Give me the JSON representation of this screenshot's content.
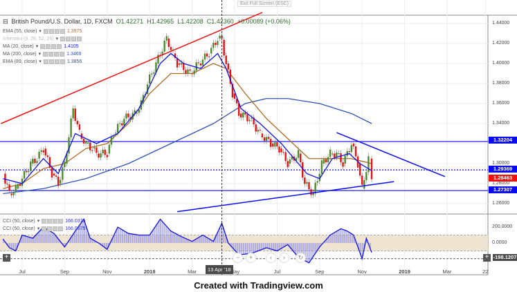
{
  "header": {
    "exit_fullscreen": "Exit Full Screen (ESC)",
    "symbol": "British Pound/U.S. Dollar, 1D, FXCM",
    "open": "O1.42271",
    "high": "H1.42965",
    "low": "L1.42208",
    "close": "C1.42360",
    "change": "+0.00089 (+0.06%)"
  },
  "indicators": [
    {
      "label": "EMA (55, close)",
      "value": "1.3975",
      "color": "#c06a10"
    },
    {
      "label": "Ichimoku (9, 26, 52, 26)",
      "value": "",
      "color": "#bbbbbb"
    },
    {
      "label": "MA (20, close)",
      "value": "1.4105",
      "color": "#1010e0"
    },
    {
      "label": "MA (200, close)",
      "value": "1.3469",
      "color": "#3050b0"
    },
    {
      "label": "EMA (89, close)",
      "value": "1.3856",
      "color": "#3050b0"
    }
  ],
  "cci_legend": [
    {
      "label": "CCI (50, close)",
      "value": "166.0375"
    },
    {
      "label": "CCI (50, close)",
      "value": "166.0375"
    }
  ],
  "price_badges": [
    {
      "value": "1.32204",
      "color": "#0a0af0"
    },
    {
      "value": "1.29369",
      "color": "#0a0af0"
    },
    {
      "value": "1.28463",
      "color": "#f01010"
    },
    {
      "value": "1.27307",
      "color": "#0a0af0"
    }
  ],
  "cci_axis": {
    "ticks": [
      "200.0000",
      "0.0000"
    ],
    "badge": "-198.1207"
  },
  "crosshair_date": "13 Apr '18",
  "footer": "Created with Tradingview.com",
  "nav": {
    "zoom_out": "−",
    "zoom_in": "+",
    "left": "‹",
    "right": "›",
    "reset": "↻"
  },
  "chart_data": {
    "type": "candlestick",
    "title": "British Pound/U.S. Dollar, 1D, FXCM",
    "ylim": [
      1.25,
      1.45
    ],
    "y_ticks": [
      "1.44000",
      "1.42000",
      "1.40000",
      "1.38000",
      "1.36000",
      "1.34000",
      "1.30000",
      "1.28000",
      "1.26000"
    ],
    "x_ticks": [
      {
        "label": "Jul",
        "t": 0
      },
      {
        "label": "Sep",
        "t": 2
      },
      {
        "label": "Nov",
        "t": 4
      },
      {
        "label": "2018",
        "t": 6
      },
      {
        "label": "Mar",
        "t": 8
      },
      {
        "label": "May",
        "t": 10
      },
      {
        "label": "Jul",
        "t": 12
      },
      {
        "label": "Sep",
        "t": 14
      },
      {
        "label": "Nov",
        "t": 16
      },
      {
        "label": "2019",
        "t": 18
      },
      {
        "label": "Mar",
        "t": 20
      },
      {
        "label": "22",
        "t": 21.8
      }
    ],
    "x_unit": "months since Jul 2017",
    "close": [
      [
        -0.9,
        1.29
      ],
      [
        -0.6,
        1.27
      ],
      [
        -0.3,
        1.275
      ],
      [
        0,
        1.285
      ],
      [
        0.4,
        1.3
      ],
      [
        0.7,
        1.305
      ],
      [
        1,
        1.315
      ],
      [
        1.4,
        1.29
      ],
      [
        1.7,
        1.28
      ],
      [
        2,
        1.3
      ],
      [
        2.4,
        1.355
      ],
      [
        2.7,
        1.33
      ],
      [
        3,
        1.32
      ],
      [
        3.3,
        1.315
      ],
      [
        3.5,
        1.31
      ],
      [
        4,
        1.31
      ],
      [
        4.3,
        1.33
      ],
      [
        4.8,
        1.345
      ],
      [
        5.3,
        1.35
      ],
      [
        5.6,
        1.36
      ],
      [
        5.9,
        1.38
      ],
      [
        6.3,
        1.4
      ],
      [
        6.8,
        1.425
      ],
      [
        7.1,
        1.41
      ],
      [
        7.3,
        1.4
      ],
      [
        7.9,
        1.39
      ],
      [
        8.3,
        1.4
      ],
      [
        8.8,
        1.41
      ],
      [
        9.2,
        1.425
      ],
      [
        9.4,
        1.4236
      ],
      [
        9.6,
        1.4
      ],
      [
        9.9,
        1.37
      ],
      [
        10.2,
        1.35
      ],
      [
        10.7,
        1.345
      ],
      [
        11.2,
        1.33
      ],
      [
        11.7,
        1.32
      ],
      [
        12.1,
        1.315
      ],
      [
        12.5,
        1.3
      ],
      [
        13,
        1.31
      ],
      [
        13.3,
        1.28
      ],
      [
        13.7,
        1.27
      ],
      [
        14.1,
        1.3
      ],
      [
        14.5,
        1.31
      ],
      [
        14.8,
        1.31
      ],
      [
        15.1,
        1.3
      ],
      [
        15.5,
        1.32
      ],
      [
        15.8,
        1.3
      ],
      [
        16,
        1.275
      ],
      [
        16.3,
        1.305
      ],
      [
        16.45,
        1.2846
      ]
    ],
    "ma20": [
      [
        -0.9,
        1.285
      ],
      [
        0,
        1.28
      ],
      [
        1,
        1.305
      ],
      [
        1.7,
        1.29
      ],
      [
        2.5,
        1.33
      ],
      [
        3.5,
        1.32
      ],
      [
        4.5,
        1.33
      ],
      [
        5.5,
        1.355
      ],
      [
        6.5,
        1.4
      ],
      [
        7,
        1.41
      ],
      [
        7.6,
        1.4
      ],
      [
        8.4,
        1.395
      ],
      [
        9.2,
        1.41
      ],
      [
        9.6,
        1.395
      ],
      [
        10.3,
        1.355
      ],
      [
        11.2,
        1.34
      ],
      [
        12.2,
        1.32
      ],
      [
        13.4,
        1.29
      ],
      [
        14,
        1.285
      ],
      [
        14.6,
        1.305
      ],
      [
        15.4,
        1.31
      ],
      [
        15.9,
        1.3
      ],
      [
        16.45,
        1.293
      ]
    ],
    "ema55": [
      [
        -0.9,
        1.275
      ],
      [
        0,
        1.28
      ],
      [
        1,
        1.295
      ],
      [
        2,
        1.3
      ],
      [
        3,
        1.315
      ],
      [
        4,
        1.32
      ],
      [
        5,
        1.34
      ],
      [
        6,
        1.37
      ],
      [
        7,
        1.39
      ],
      [
        8,
        1.39
      ],
      [
        9,
        1.4
      ],
      [
        9.6,
        1.395
      ],
      [
        10.5,
        1.37
      ],
      [
        11.5,
        1.345
      ],
      [
        12.5,
        1.325
      ],
      [
        13.5,
        1.305
      ],
      [
        14.5,
        1.305
      ],
      [
        15.5,
        1.305
      ],
      [
        16.45,
        1.3
      ]
    ],
    "ma200": [
      [
        -0.9,
        1.27
      ],
      [
        1,
        1.275
      ],
      [
        3,
        1.285
      ],
      [
        5,
        1.3
      ],
      [
        7,
        1.32
      ],
      [
        9,
        1.34
      ],
      [
        10.5,
        1.36
      ],
      [
        11.5,
        1.365
      ],
      [
        12.5,
        1.365
      ],
      [
        14,
        1.36
      ],
      [
        15.5,
        1.35
      ],
      [
        16.45,
        1.34
      ]
    ],
    "trendlines": [
      {
        "color": "#f01010",
        "from": [
          -1,
          1.34
        ],
        "to": [
          11.3,
          1.451
        ]
      },
      {
        "color": "#0a0af0",
        "from": [
          14.8,
          1.331
        ],
        "to": [
          19.9,
          1.287
        ]
      },
      {
        "color": "#0a0af0",
        "from": [
          7.3,
          1.252
        ],
        "to": [
          17.5,
          1.282
        ]
      }
    ],
    "levels": [
      {
        "value": 1.32204,
        "style": "solid"
      },
      {
        "value": 1.29369,
        "style": "dotted"
      },
      {
        "value": 1.27307,
        "style": "solid"
      }
    ],
    "crosshair_t": 9.4,
    "cci": {
      "ylim": [
        -250,
        300
      ],
      "band": [
        -100,
        100
      ],
      "values": [
        [
          -0.9,
          50
        ],
        [
          -0.6,
          -60
        ],
        [
          -0.3,
          -100
        ],
        [
          0,
          100
        ],
        [
          0.5,
          60
        ],
        [
          1,
          200
        ],
        [
          1.5,
          120
        ],
        [
          2,
          -50
        ],
        [
          2.5,
          150
        ],
        [
          2.9,
          300
        ],
        [
          3.2,
          60
        ],
        [
          3.6,
          0
        ],
        [
          4,
          -80
        ],
        [
          4.5,
          200
        ],
        [
          5,
          120
        ],
        [
          5.5,
          100
        ],
        [
          6,
          100
        ],
        [
          6.5,
          300
        ],
        [
          7,
          150
        ],
        [
          7.5,
          80
        ],
        [
          8,
          20
        ],
        [
          8.5,
          100
        ],
        [
          9,
          20
        ],
        [
          9.4,
          250
        ],
        [
          9.7,
          0
        ],
        [
          10.2,
          -150
        ],
        [
          10.8,
          -130
        ],
        [
          11.5,
          -60
        ],
        [
          12,
          -100
        ],
        [
          12.5,
          -20
        ],
        [
          13,
          -180
        ],
        [
          13.5,
          -250
        ],
        [
          14,
          -50
        ],
        [
          14.5,
          100
        ],
        [
          15,
          180
        ],
        [
          15.3,
          150
        ],
        [
          15.6,
          100
        ],
        [
          16,
          -200
        ],
        [
          16.2,
          60
        ],
        [
          16.45,
          -120
        ]
      ]
    }
  }
}
